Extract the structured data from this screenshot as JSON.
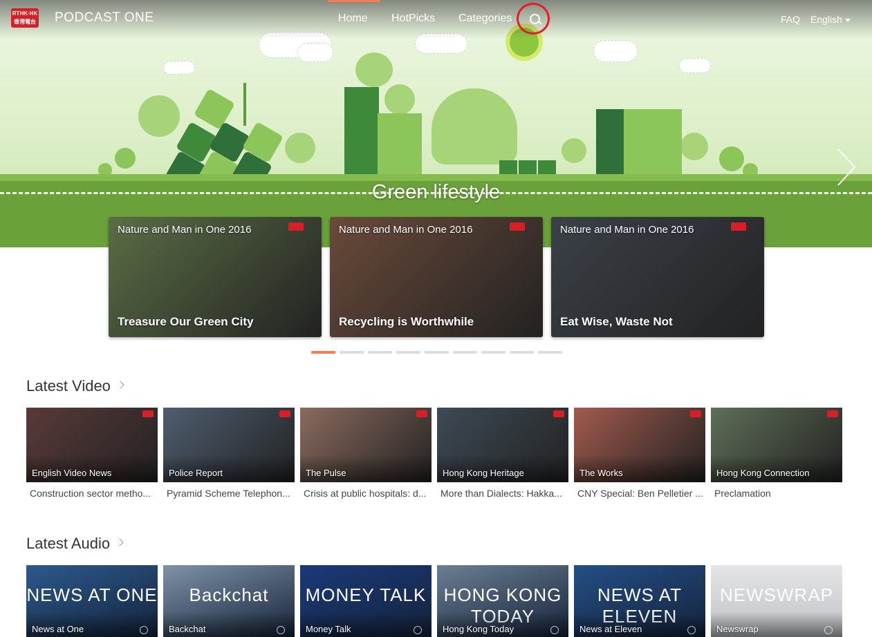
{
  "header": {
    "logo_top": "RTHK·HK",
    "logo_bottom": "香港電台",
    "brand": "PODCAST ONE",
    "nav": [
      {
        "label": "Home",
        "active": true
      },
      {
        "label": "HotPicks",
        "active": false
      },
      {
        "label": "Categories",
        "active": false
      }
    ],
    "faq": "FAQ",
    "language": "English",
    "icons": {
      "search": "search-icon",
      "language_caret": "chevron-down-icon",
      "next": "chevron-right-icon"
    }
  },
  "hero": {
    "title": "Green lifestyle",
    "features": [
      {
        "series": "Nature and Man in One 2016",
        "title": "Treasure Our Green City",
        "color": "#5b6d45"
      },
      {
        "series": "Nature and Man in One 2016",
        "title": "Recycling is Worthwhile",
        "color": "#6a4a3a"
      },
      {
        "series": "Nature and Man in One 2016",
        "title": "Eat Wise, Waste Not",
        "color": "#3b4148"
      }
    ],
    "pagination": {
      "total": 9,
      "active": 0
    }
  },
  "latest_video": {
    "title": "Latest Video",
    "items": [
      {
        "program": "English Video News",
        "episode": "Construction sector metho...",
        "color": "#5a3a3a"
      },
      {
        "program": "Police Report",
        "episode": "Pyramid Scheme Telephon...",
        "color": "#4f5d6f"
      },
      {
        "program": "The Pulse",
        "episode": "Crisis at public hospitals: d...",
        "color": "#8a6b5e"
      },
      {
        "program": "Hong Kong Heritage",
        "episode": "More than Dialects: Hakka...",
        "color": "#3e4a55"
      },
      {
        "program": "The Works",
        "episode": "CNY Special: Ben Pelletier ...",
        "color": "#a25a4d"
      },
      {
        "program": "Hong Kong Connection",
        "episode": "Preclamation",
        "color": "#5f6e58"
      }
    ]
  },
  "latest_audio": {
    "title": "Latest Audio",
    "items": [
      {
        "program": "News at One",
        "art": "NEWS AT ONE",
        "color": "#2c5a8c"
      },
      {
        "program": "Backchat",
        "art": "Backchat",
        "color": "#7f93a8"
      },
      {
        "program": "Money Talk",
        "art": "MONEY TALK",
        "color": "#1b3a7a"
      },
      {
        "program": "Hong Kong Today",
        "art": "HONG KONG TODAY",
        "color": "#6b7f93"
      },
      {
        "program": "News at Eleven",
        "art": "NEWS AT ELEVEN",
        "color": "#244f86"
      },
      {
        "program": "Newswrap",
        "art": "NEWSWRAP",
        "color": "#c9c9cc"
      }
    ]
  },
  "colors": {
    "accent": "#ff7a50",
    "brand_red": "#d61f26",
    "annotation": "#e3202a"
  }
}
